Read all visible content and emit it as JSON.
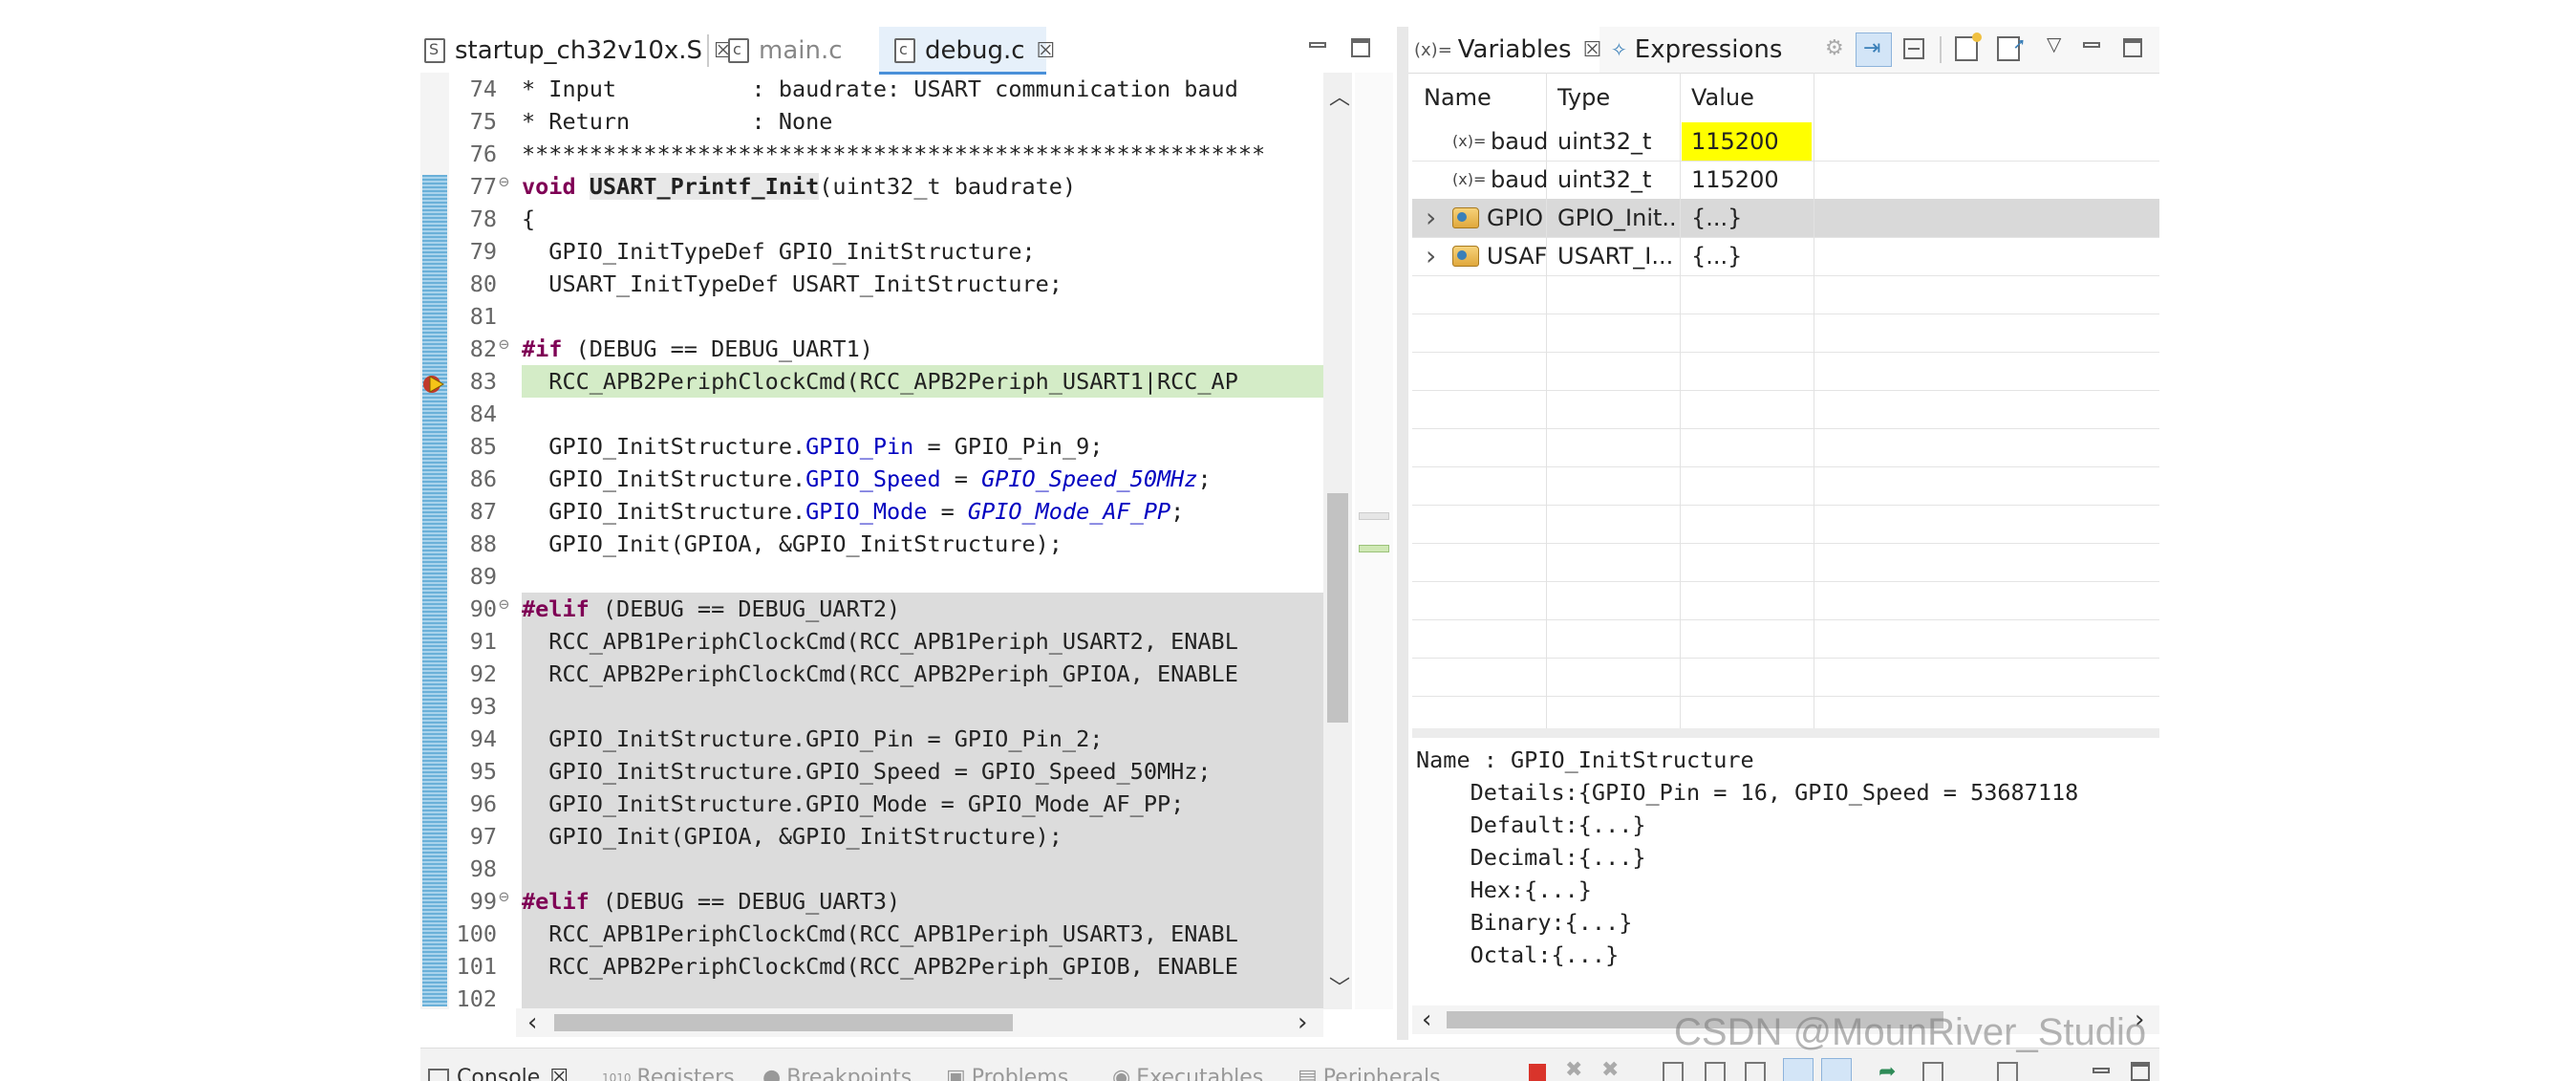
{
  "editor": {
    "tabs": [
      {
        "label": "startup_ch32v10x.S",
        "close": "☒",
        "file_icon": "S"
      },
      {
        "label": "main.c",
        "file_icon": "c"
      },
      {
        "label": "debug.c",
        "close": "☒",
        "file_icon": "c"
      }
    ],
    "lines": [
      {
        "n": "74",
        "text": "* Input          : baudrate: USART communication baud"
      },
      {
        "n": "75",
        "text": "* Return         : None"
      },
      {
        "n": "76",
        "text": "*******************************************************"
      },
      {
        "n": "77",
        "fold": "⊖",
        "kw": "void",
        "fn": "USART_Printf_Init",
        "rest": "(uint32_t baudrate)"
      },
      {
        "n": "78",
        "text": "{"
      },
      {
        "n": "79",
        "text": "  GPIO_InitTypeDef GPIO_InitStructure;"
      },
      {
        "n": "80",
        "text": "  USART_InitTypeDef USART_InitStructure;"
      },
      {
        "n": "81",
        "text": ""
      },
      {
        "n": "82",
        "fold": "⊖",
        "kw": "#if",
        "rest": " (DEBUG == DEBUG_UART1)"
      },
      {
        "n": "83",
        "text": "  RCC_APB2PeriphClockCmd(RCC_APB2Periph_USART1|RCC_AP"
      },
      {
        "n": "84",
        "text": ""
      },
      {
        "n": "85",
        "pre": "  GPIO_InitStructure.",
        "field": "GPIO_Pin",
        "post": " = GPIO_Pin_9;"
      },
      {
        "n": "86",
        "pre": "  GPIO_InitStructure.",
        "field": "GPIO_Speed",
        "mid": " = ",
        "enum": "GPIO_Speed_50MHz",
        "post": ";"
      },
      {
        "n": "87",
        "pre": "  GPIO_InitStructure.",
        "field": "GPIO_Mode",
        "mid": " = ",
        "enum": "GPIO_Mode_AF_PP",
        "post": ";"
      },
      {
        "n": "88",
        "text": "  GPIO_Init(GPIOA, &GPIO_InitStructure);"
      },
      {
        "n": "89",
        "text": ""
      },
      {
        "n": "90",
        "fold": "⊖",
        "kw": "#elif",
        "rest": " (DEBUG == DEBUG_UART2)"
      },
      {
        "n": "91",
        "text": "  RCC_APB1PeriphClockCmd(RCC_APB1Periph_USART2, ENABL"
      },
      {
        "n": "92",
        "text": "  RCC_APB2PeriphClockCmd(RCC_APB2Periph_GPIOA, ENABLE"
      },
      {
        "n": "93",
        "text": ""
      },
      {
        "n": "94",
        "text": "  GPIO_InitStructure.GPIO_Pin = GPIO_Pin_2;"
      },
      {
        "n": "95",
        "text": "  GPIO_InitStructure.GPIO_Speed = GPIO_Speed_50MHz;"
      },
      {
        "n": "96",
        "text": "  GPIO_InitStructure.GPIO_Mode = GPIO_Mode_AF_PP;"
      },
      {
        "n": "97",
        "text": "  GPIO_Init(GPIOA, &GPIO_InitStructure);"
      },
      {
        "n": "98",
        "text": ""
      },
      {
        "n": "99",
        "fold": "⊖",
        "kw": "#elif",
        "rest": " (DEBUG == DEBUG_UART3)"
      },
      {
        "n": "100",
        "text": "  RCC_APB1PeriphClockCmd(RCC_APB1Periph_USART3, ENABL"
      },
      {
        "n": "101",
        "text": "  RCC_APB2PeriphClockCmd(RCC_APB2Periph_GPIOB, ENABLE"
      },
      {
        "n": "102",
        "text": ""
      }
    ]
  },
  "variables_view": {
    "tab_prefix": "(x)=",
    "tab_label": "Variables",
    "tab_close": "☒",
    "expressions_label": "Expressions",
    "columns": [
      "Name",
      "Type",
      "Value"
    ],
    "rows": [
      {
        "icon": "(x)=",
        "name": "baud",
        "type": "uint32_t",
        "value": "115200"
      },
      {
        "icon": "(x)=",
        "name": "baud",
        "type": "uint32_t",
        "value": "115200"
      },
      {
        "expand": "›",
        "name": "GPIO",
        "type": "GPIO_Init...",
        "value": "{...}"
      },
      {
        "expand": "›",
        "name": "USAF",
        "type": "USART_I...",
        "value": "{...}"
      }
    ],
    "details": [
      "Name : GPIO_InitStructure",
      "    Details:{GPIO_Pin = 16, GPIO_Speed = 53687118",
      "    Default:{...}",
      "    Decimal:{...}",
      "    Hex:{...}",
      "    Binary:{...}",
      "    Octal:{...}"
    ]
  },
  "bottom_bar": {
    "tabs": [
      "Console",
      "Registers",
      "Breakpoints",
      "Problems",
      "Executables",
      "Peripherals"
    ]
  },
  "watermark": "CSDN @MounRiver_Studio",
  "colors": {
    "highlight_value": "#ffff00",
    "current_line": "#d4ecc7",
    "inactive_code": "#dcdcdc",
    "keyword": "#7f0055",
    "field": "#0000c0"
  }
}
